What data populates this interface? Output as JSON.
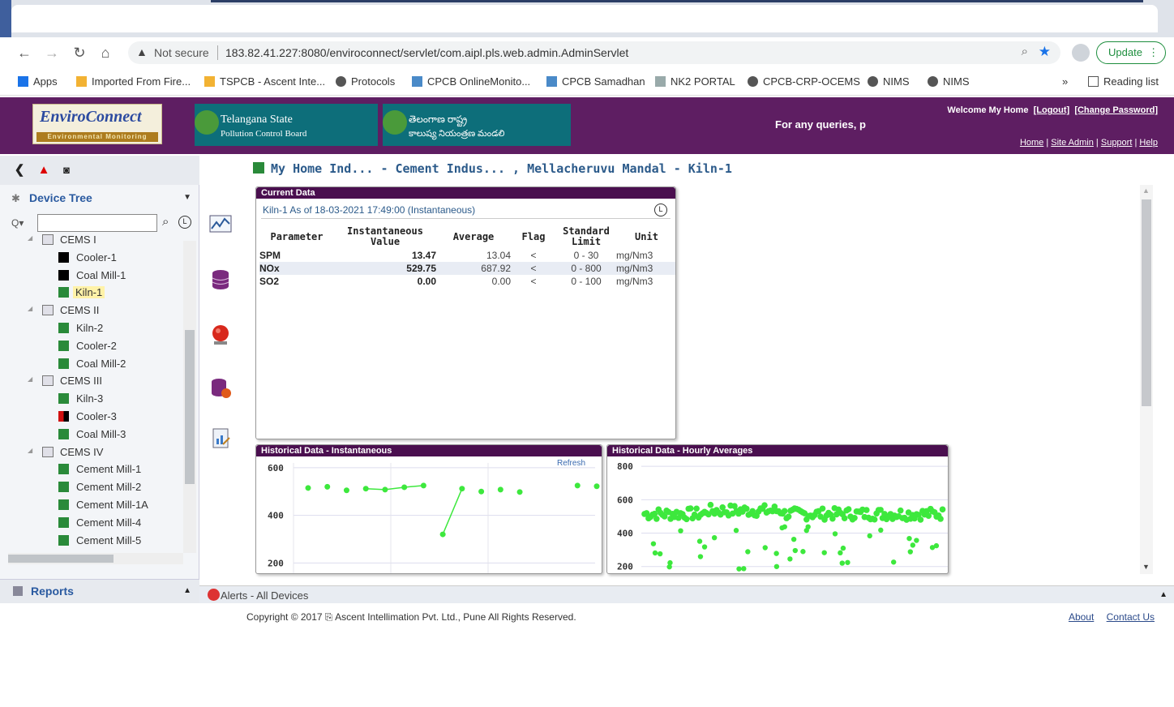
{
  "browser": {
    "security_label": "Not secure",
    "url": "183.82.41.227:8080/enviroconnect/servlet/com.aipl.pls.web.admin.AdminServlet",
    "update_label": "Update",
    "bookmarks": [
      {
        "label": "Apps",
        "icon": "apps-grid-icon",
        "color": "#1a73e8"
      },
      {
        "label": "Imported From Fire...",
        "icon": "folder-icon",
        "color": "#f2b233"
      },
      {
        "label": "TSPCB - Ascent Inte...",
        "icon": "site-icon",
        "color": "#f2b233"
      },
      {
        "label": "Protocols",
        "icon": "globe-icon",
        "color": "#555"
      },
      {
        "label": "CPCB OnlineMonito...",
        "icon": "site-icon",
        "color": "#4a8ac8"
      },
      {
        "label": "CPCB Samadhan",
        "icon": "site-icon",
        "color": "#4a8ac8"
      },
      {
        "label": "NK2 PORTAL",
        "icon": "doc-icon",
        "color": "#9aa"
      },
      {
        "label": "CPCB-CRP-OCEMS",
        "icon": "globe-icon",
        "color": "#555"
      },
      {
        "label": "NIMS",
        "icon": "globe-icon",
        "color": "#555"
      },
      {
        "label": "NIMS",
        "icon": "globe-icon",
        "color": "#555"
      }
    ],
    "reading_list": "Reading list"
  },
  "header": {
    "logo_title": "EnviroConnect",
    "logo_subtitle": "Environmental Monitoring",
    "board_line1": "Telangana State",
    "board_line2": "Pollution Control Board",
    "board_telugu_line1": "తెలంగాణ రాష్ట్ర",
    "board_telugu_line2": "కాలుష్య నియంత్రణ మండలి",
    "queries": "For any queries, p",
    "welcome": "Welcome My Home",
    "logout": "[Logout]",
    "change_password": "[Change Password]",
    "links": [
      "Home",
      "Site Admin",
      "Support",
      "Help"
    ]
  },
  "sidebar": {
    "device_tree_label": "Device Tree",
    "reports_label": "Reports",
    "tree": [
      {
        "label": "CEMS I",
        "type": "group"
      },
      {
        "label": "Cooler-1",
        "type": "device",
        "status": "#000000"
      },
      {
        "label": "Coal Mill-1",
        "type": "device",
        "status": "#000000"
      },
      {
        "label": "Kiln-1",
        "type": "device",
        "status": "#2a8a3a",
        "selected": true
      },
      {
        "label": "CEMS II",
        "type": "group"
      },
      {
        "label": "Kiln-2",
        "type": "device",
        "status": "#2a8a3a"
      },
      {
        "label": "Cooler-2",
        "type": "device",
        "status": "#2a8a3a"
      },
      {
        "label": "Coal Mill-2",
        "type": "device",
        "status": "#2a8a3a"
      },
      {
        "label": "CEMS III",
        "type": "group"
      },
      {
        "label": "Kiln-3",
        "type": "device",
        "status": "#2a8a3a"
      },
      {
        "label": "Cooler-3",
        "type": "device",
        "status": "split"
      },
      {
        "label": "Coal Mill-3",
        "type": "device",
        "status": "#2a8a3a"
      },
      {
        "label": "CEMS IV",
        "type": "group"
      },
      {
        "label": "Cement Mill-1",
        "type": "device",
        "status": "#2a8a3a"
      },
      {
        "label": "Cement Mill-2",
        "type": "device",
        "status": "#2a8a3a"
      },
      {
        "label": "Cement Mill-1A",
        "type": "device",
        "status": "#2a8a3a"
      },
      {
        "label": "Cement Mill-4",
        "type": "device",
        "status": "#2a8a3a"
      },
      {
        "label": "Cement Mill-5",
        "type": "device",
        "status": "#2a8a3a"
      }
    ]
  },
  "main": {
    "title": "My Home Ind...  - Cement Indus... , Mellacheruvu Mandal  - Kiln-1",
    "current_data": {
      "panel_title": "Current Data",
      "as_of": "Kiln-1 As of 18-03-2021 17:49:00 (Instantaneous)",
      "columns": [
        "Parameter",
        "Instantaneous Value",
        "Average",
        "Flag",
        "Standard Limit",
        "Unit"
      ],
      "rows": [
        {
          "parameter": "SPM",
          "value": "13.47",
          "average": "13.04",
          "flag": "<",
          "limit": "0 - 30",
          "unit": "mg/Nm3"
        },
        {
          "parameter": "NOx",
          "value": "529.75",
          "average": "687.92",
          "flag": "<",
          "limit": "0 - 800",
          "unit": "mg/Nm3"
        },
        {
          "parameter": "SO2",
          "value": "0.00",
          "average": "0.00",
          "flag": "<",
          "limit": "0 - 100",
          "unit": "mg/Nm3"
        }
      ]
    },
    "hist_inst": {
      "panel_title": "Historical Data - Instantaneous",
      "refresh": "Refresh",
      "y_ticks": [
        "600",
        "400",
        "200"
      ]
    },
    "hist_hourly": {
      "panel_title": "Historical Data - Hourly Averages",
      "y_ticks": [
        "800",
        "600",
        "400",
        "200"
      ]
    }
  },
  "chart_data": [
    {
      "type": "line",
      "title": "Historical Data - Instantaneous",
      "ylim": [
        150,
        620
      ],
      "series_color": "#3de83d",
      "x": [
        1,
        2,
        3,
        4,
        5,
        6,
        7,
        8,
        9,
        10,
        11,
        12,
        13,
        14,
        15,
        16
      ],
      "values": [
        515,
        520,
        505,
        512,
        508,
        518,
        525,
        320,
        512,
        500,
        508,
        498,
        null,
        null,
        525,
        522
      ],
      "segments": [
        [
          3,
          6
        ],
        [
          7,
          8
        ]
      ]
    },
    {
      "type": "scatter",
      "title": "Historical Data - Hourly Averages",
      "ylim": [
        150,
        820
      ],
      "series_color": "#3de83d"
    }
  ],
  "alerts_bar": {
    "label": "Alerts - All Devices"
  },
  "footer": {
    "copyright": "Copyright © 2017 ⎘ Ascent Intellimation Pvt. Ltd., Pune All Rights Reserved.",
    "about": "About",
    "contact": "Contact Us"
  }
}
